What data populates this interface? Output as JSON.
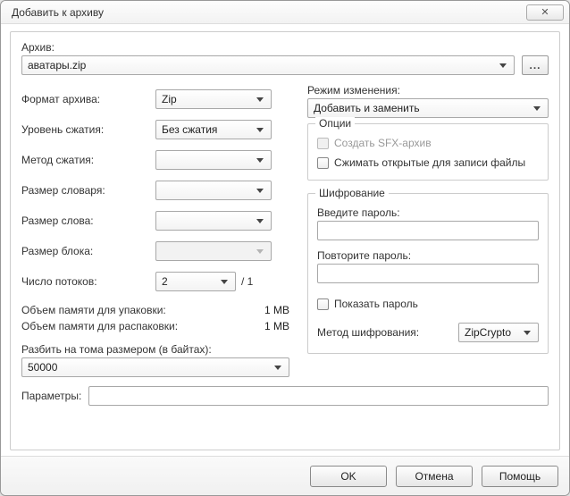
{
  "window": {
    "title": "Добавить к архиву",
    "close_glyph": "✕"
  },
  "archive": {
    "label": "Архив:",
    "value": "аватары.zip",
    "browse_label": "..."
  },
  "left": {
    "format_label": "Формат архива:",
    "format_value": "Zip",
    "level_label": "Уровень сжатия:",
    "level_value": "Без сжатия",
    "method_label": "Метод сжатия:",
    "method_value": "",
    "dict_label": "Размер словаря:",
    "dict_value": "",
    "word_label": "Размер слова:",
    "word_value": "",
    "block_label": "Размер блока:",
    "block_value": "",
    "threads_label": "Число потоков:",
    "threads_value": "2",
    "threads_suffix": "/ 1",
    "mem_pack_label": "Объем памяти для упаковки:",
    "mem_pack_value": "1 MB",
    "mem_unpack_label": "Объем памяти для распаковки:",
    "mem_unpack_value": "1 MB",
    "split_label": "Разбить на тома размером (в байтах):",
    "split_value": "50000"
  },
  "right": {
    "update_label": "Режим изменения:",
    "update_value": "Добавить и заменить",
    "options_title": "Опции",
    "sfx_label": "Создать SFX-архив",
    "open_files_label": "Сжимать открытые для записи файлы",
    "enc_title": "Шифрование",
    "pwd_label": "Введите пароль:",
    "pwd_value": "",
    "pwd2_label": "Повторите пароль:",
    "pwd2_value": "",
    "show_pwd_label": "Показать пароль",
    "enc_method_label": "Метод шифрования:",
    "enc_method_value": "ZipCrypto"
  },
  "params": {
    "label": "Параметры:",
    "value": ""
  },
  "footer": {
    "ok": "OK",
    "cancel": "Отмена",
    "help": "Помощь"
  }
}
